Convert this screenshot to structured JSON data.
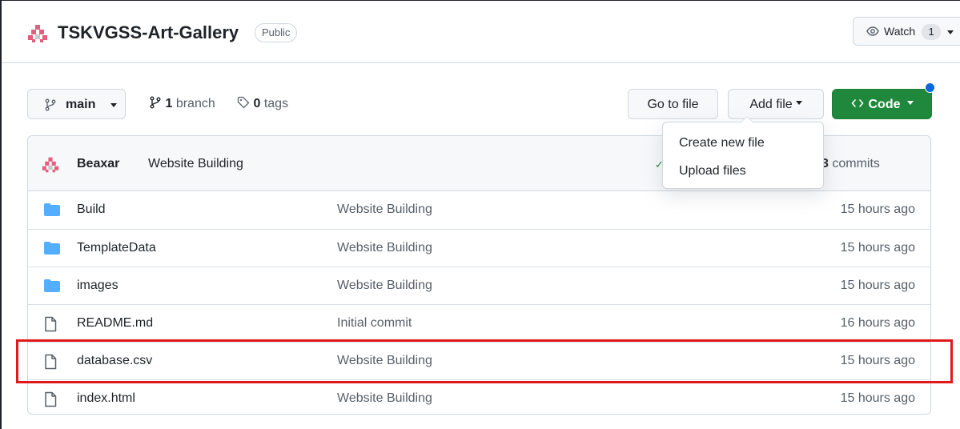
{
  "repo": {
    "name": "TSKVGSS-Art-Gallery",
    "visibility": "Public",
    "watch_label": "Watch",
    "watch_count": "1"
  },
  "toolbar": {
    "branch": "main",
    "branches_count": "1",
    "branches_label": "branch",
    "tags_count": "0",
    "tags_label": "tags",
    "goto_file": "Go to file",
    "add_file": "Add file",
    "code": "Code"
  },
  "add_file_menu": {
    "items": [
      "Create new file",
      "Upload files"
    ]
  },
  "latest_commit": {
    "author": "Beaxar",
    "message": "Website Building",
    "status": "✓",
    "commits_count": "3",
    "commits_label": "commits"
  },
  "files": [
    {
      "name": "Build",
      "type": "folder",
      "commit": "Website Building",
      "time": "15 hours ago"
    },
    {
      "name": "TemplateData",
      "type": "folder",
      "commit": "Website Building",
      "time": "15 hours ago"
    },
    {
      "name": "images",
      "type": "folder",
      "commit": "Website Building",
      "time": "15 hours ago"
    },
    {
      "name": "README.md",
      "type": "file",
      "commit": "Initial commit",
      "time": "16 hours ago"
    },
    {
      "name": "database.csv",
      "type": "file",
      "commit": "Website Building",
      "time": "15 hours ago"
    },
    {
      "name": "index.html",
      "type": "file",
      "commit": "Website Building",
      "time": "15 hours ago"
    }
  ],
  "colors": {
    "primary_green": "#1f883d",
    "folder_blue": "#54aeff",
    "highlight_red": "#e0191b",
    "notification_blue": "#0969da"
  },
  "icons": {
    "repo_avatar": "identicon-icon",
    "watch": "eye-icon",
    "branch": "git-branch-icon",
    "tags": "tag-icon",
    "code": "code-icon",
    "history": "history-icon",
    "folder": "folder-icon",
    "file": "file-icon"
  }
}
